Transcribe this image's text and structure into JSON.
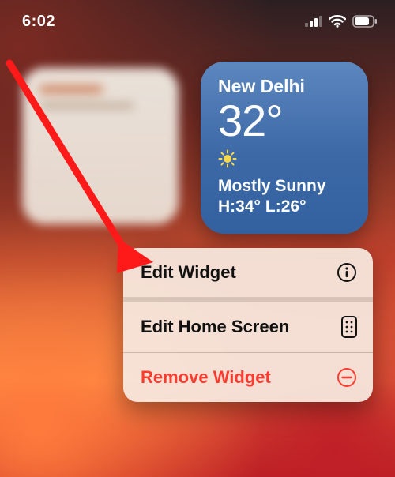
{
  "status": {
    "time": "6:02",
    "signal_bars": 3,
    "wifi_bars": 3,
    "battery_level": 0.75
  },
  "weather": {
    "location": "New Delhi",
    "temperature": "32°",
    "condition_icon": "sun-icon",
    "condition": "Mostly Sunny",
    "high_label": "H:34°",
    "low_label": "L:26°"
  },
  "menu": {
    "items": [
      {
        "label": "Edit Widget",
        "icon": "info-circle-icon",
        "destructive": false
      },
      {
        "label": "Edit Home Screen",
        "icon": "apps-grid-icon",
        "destructive": false
      },
      {
        "label": "Remove Widget",
        "icon": "minus-circle-icon",
        "destructive": true
      }
    ]
  },
  "annotation": {
    "color": "#ff1a1a",
    "target": "menu-item-edit-widget"
  }
}
